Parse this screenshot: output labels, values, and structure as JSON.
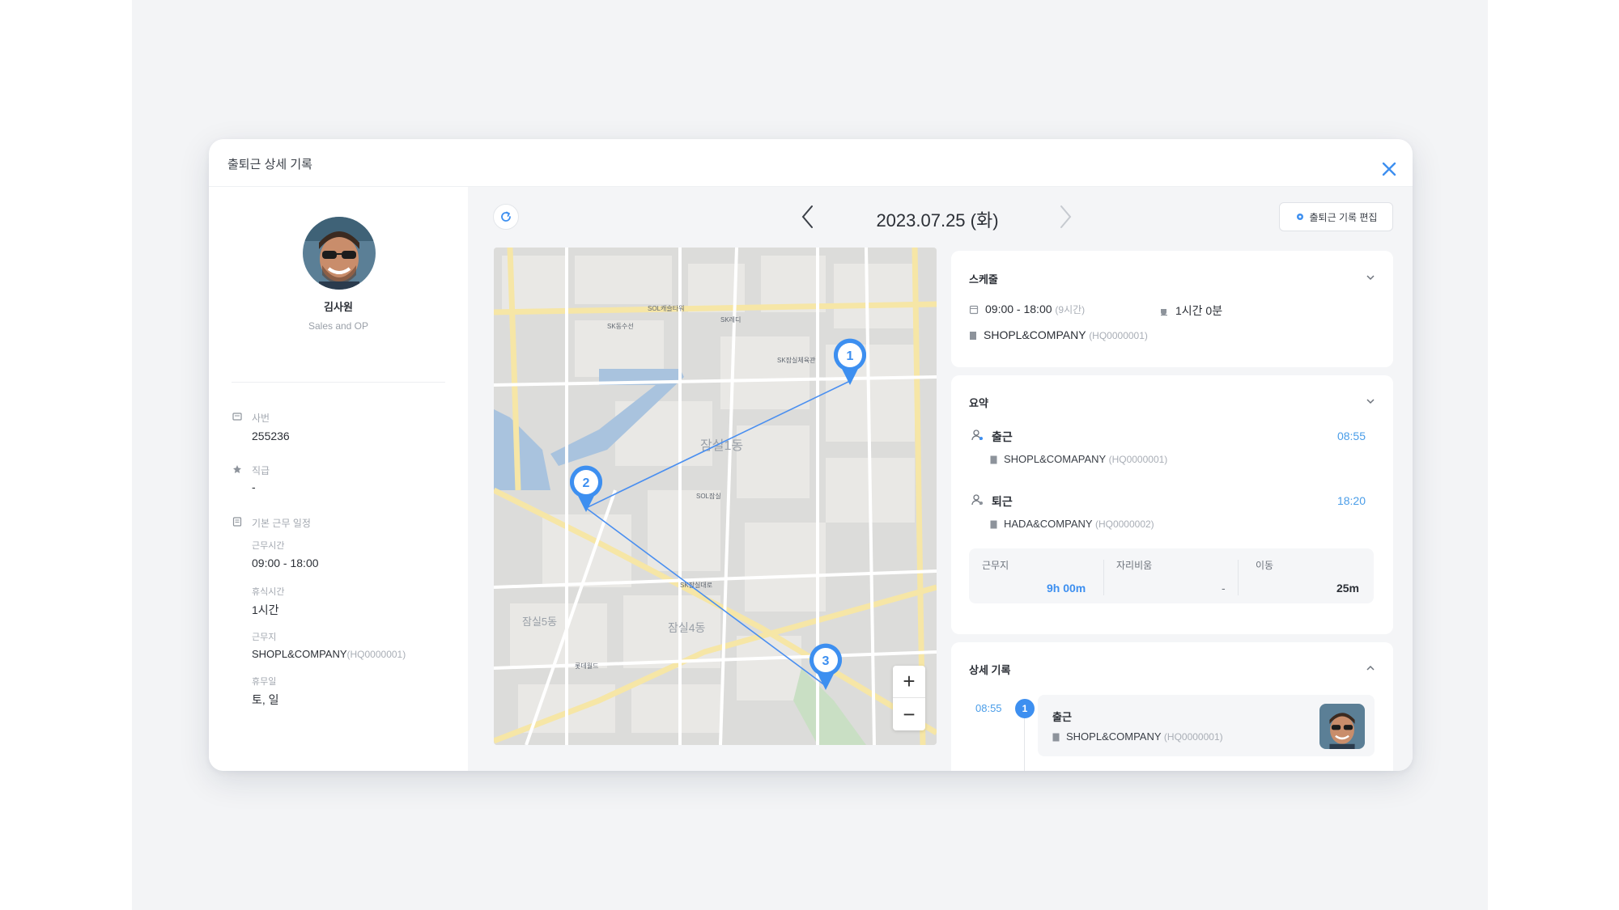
{
  "modal": {
    "title": "출퇴근 상세 기록"
  },
  "profile": {
    "name": "김사원",
    "department": "Sales and OP",
    "employee_no_label": "사번",
    "employee_no": "255236",
    "position_label": "직급",
    "position": "-",
    "schedule_label": "기본 근무 일정",
    "work_hours_label": "근무시간",
    "work_hours": "09:00 - 18:00",
    "break_label": "휴식시간",
    "break_value": "1시간",
    "workplace_label": "근무지",
    "workplace": "SHOPL&COMPANY",
    "workplace_code": "(HQ0000001)",
    "holiday_label": "휴무일",
    "holiday": "토, 일"
  },
  "toolbar": {
    "date": "2023.07.25 (화)",
    "edit_label": "출퇴근 기록 편집"
  },
  "map": {
    "markers": [
      "1",
      "2",
      "3"
    ],
    "zoom_in": "+",
    "zoom_out": "−",
    "district_label": "잠실1동",
    "district_label_2": "잠실4동",
    "district_label_3": "잠실5동",
    "place_labels": [
      "SOL캐슬타워",
      "SK동수선",
      "SK레디",
      "SK잠실체육관",
      "SOL잠실",
      "SK잠실대로",
      "롯데월드"
    ]
  },
  "schedule": {
    "title": "스케줄",
    "time": "09:00 - 18:00",
    "time_note": "(9시간)",
    "break": "1시간 0분",
    "workplace": "SHOPL&COMPANY",
    "workplace_code": "(HQ0000001)"
  },
  "summary": {
    "title": "요약",
    "checkin_label": "출근",
    "checkin_time": "08:55",
    "checkin_place": "SHOPL&COMAPANY",
    "checkin_code": "(HQ0000001)",
    "checkout_label": "퇴근",
    "checkout_time": "18:20",
    "checkout_place": "HADA&COMPANY",
    "checkout_code": "(HQ0000002)",
    "stats": [
      {
        "label": "근무지",
        "value": "9h 00m"
      },
      {
        "label": "자리비움",
        "value": "-"
      },
      {
        "label": "이동",
        "value": "25m"
      }
    ]
  },
  "detail": {
    "title": "상세 기록",
    "time": "08:55",
    "number": "1",
    "label": "출근",
    "place": "SHOPL&COMPANY",
    "code": "(HQ0000001)"
  },
  "colors": {
    "accent": "#3d8ff0",
    "route": "#4a8ff0"
  }
}
